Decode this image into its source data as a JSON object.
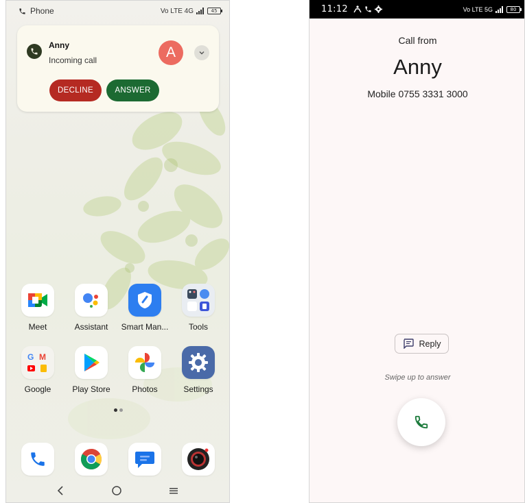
{
  "left_screen": {
    "status_bar": {
      "app_name": "Phone",
      "indicators": "Vo LTE 4G",
      "battery_level": "45"
    },
    "notification": {
      "caller": "Anny",
      "subtitle": "Incoming call",
      "avatar_letter": "A",
      "decline_label": "DECLINE",
      "answer_label": "ANSWER",
      "colors": {
        "decline": "#b52a22",
        "answer": "#1c6a32",
        "avatar": "#ec6b60"
      }
    },
    "apps": [
      {
        "label": "Meet",
        "icon": "meet-icon"
      },
      {
        "label": "Assistant",
        "icon": "assistant-icon"
      },
      {
        "label": "Smart Man...",
        "icon": "smart-manager-icon"
      },
      {
        "label": "Tools",
        "icon": "tools-folder-icon"
      },
      {
        "label": "Google",
        "icon": "google-folder-icon"
      },
      {
        "label": "Play Store",
        "icon": "play-store-icon"
      },
      {
        "label": "Photos",
        "icon": "photos-icon"
      },
      {
        "label": "Settings",
        "icon": "settings-icon"
      }
    ],
    "dock": [
      {
        "icon": "phone-icon"
      },
      {
        "icon": "chrome-icon"
      },
      {
        "icon": "messages-icon"
      },
      {
        "icon": "camera-icon"
      }
    ],
    "nav": [
      "back-icon",
      "home-icon",
      "menu-icon"
    ]
  },
  "right_screen": {
    "status_bar": {
      "time": "11:12",
      "indicators": "Vo LTE 5G",
      "battery_level": "80"
    },
    "call_from": "Call from",
    "caller_name": "Anny",
    "caller_number": "Mobile 0755 3331 3000",
    "reply_label": "Reply",
    "swipe_hint": "Swipe up to answer",
    "accent": "#1c7a3c"
  }
}
